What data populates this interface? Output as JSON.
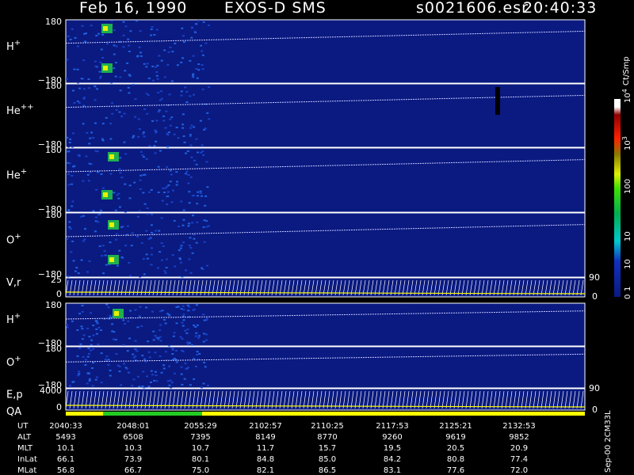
{
  "header": {
    "date": "Feb 16, 1990",
    "mission": "EXOS-D SMS",
    "file": "s0021606.esr",
    "time": "20:40:33"
  },
  "colors": {
    "background": "#000000",
    "panel_bg": "#0a1a80",
    "trace": "#c8c8ff",
    "qa_yellow": "#ffff00",
    "qa_green": "#22cc22"
  },
  "panels": [
    {
      "label": "H",
      "sup": "+",
      "ymax": "180",
      "ymin": "−180"
    },
    {
      "label": "He",
      "sup": "++",
      "ymax": "180",
      "ymin": "−180"
    },
    {
      "label": "He",
      "sup": "+",
      "ymax": "180",
      "ymin": "−180"
    },
    {
      "label": "O",
      "sup": "+",
      "ymax": "180",
      "ymin": "−180"
    },
    {
      "label": "V,r",
      "sup": "",
      "ymax": "25",
      "ymin": "0",
      "right_top": "90",
      "right_bottom": "0"
    },
    {
      "label": "H",
      "sup": "+",
      "ymax": "180",
      "ymin": "−180"
    },
    {
      "label": "O",
      "sup": "+",
      "ymax": "180",
      "ymin": "−180"
    },
    {
      "label": "E,p",
      "sup": "",
      "ymax": "4000",
      "ymin": "0",
      "right_top": "90",
      "right_bottom": "0"
    }
  ],
  "qa_label": "QA",
  "colorbar": {
    "title": "Ct/Smp",
    "ticks": [
      "10",
      "10",
      "100",
      "10",
      "10",
      "1",
      "0"
    ],
    "tick_exps": [
      "4",
      "3",
      "",
      "",
      "",
      "",
      ""
    ]
  },
  "footer_note": "Sep-00 2CM33L",
  "table": {
    "row_labels": [
      "UT",
      "ALT",
      "MLT",
      "InLat",
      "MLat"
    ],
    "columns": [
      [
        "2040:33",
        "5493",
        "10.1",
        "66.1",
        "56.8"
      ],
      [
        "2048:01",
        "6508",
        "10.3",
        "73.9",
        "66.7"
      ],
      [
        "2055:29",
        "7395",
        "10.7",
        "80.1",
        "75.0"
      ],
      [
        "2102:57",
        "8149",
        "11.7",
        "84.8",
        "82.1"
      ],
      [
        "2110:25",
        "8770",
        "15.7",
        "85.0",
        "86.5"
      ],
      [
        "2117:53",
        "9260",
        "19.5",
        "84.2",
        "83.1"
      ],
      [
        "2125:21",
        "9619",
        "20.5",
        "80.8",
        "77.6"
      ],
      [
        "2132:53",
        "9852",
        "20.9",
        "77.4",
        "72.0"
      ]
    ]
  },
  "chart_data": {
    "type": "heatmap",
    "x_ticks": [
      "2040:33",
      "2048:01",
      "2055:29",
      "2102:57",
      "2110:25",
      "2117:53",
      "2125:21",
      "2132:53"
    ],
    "panels": [
      "H+",
      "He++",
      "He+",
      "O+",
      "V,r",
      "H+",
      "O+",
      "E,p"
    ],
    "ylim_pitch": [
      -180,
      180
    ],
    "colorbar_unit": "Ct/Smp",
    "colorbar_scale": "log"
  }
}
